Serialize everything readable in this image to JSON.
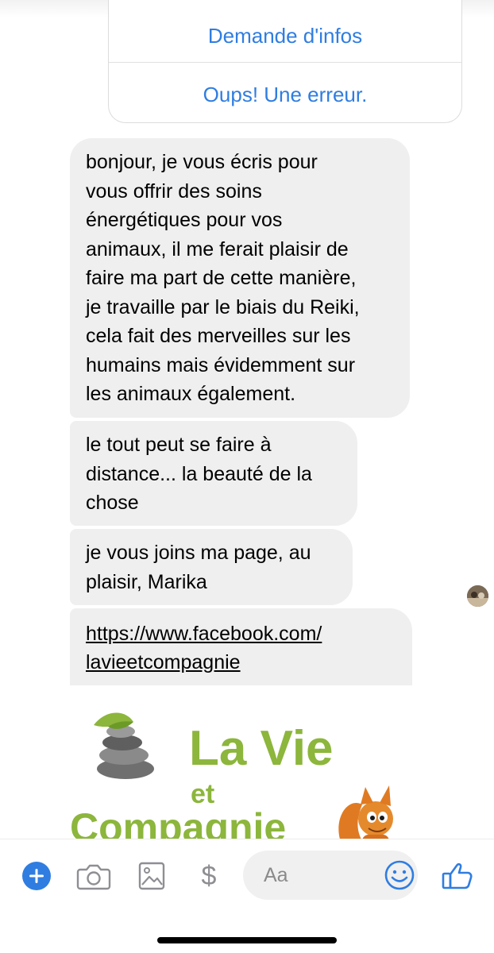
{
  "quick_replies": [
    "Demande d'infos",
    "Oups! Une erreur."
  ],
  "messages": {
    "first": [
      "bonjour, je vous écris pour",
      "vous offrir des soins",
      "énergétiques pour vos",
      "animaux, il me ferait plaisir de",
      "faire ma part de cette manière,",
      "je travaille par le biais du Reiki,",
      "cela fait des merveilles sur les",
      "humains mais évidemment sur",
      "les animaux également."
    ],
    "second": [
      "le tout peut se faire à",
      "distance... la beauté de la",
      "chose"
    ],
    "third": [
      "je vous joins ma page, au",
      "plaisir, Marika"
    ],
    "link": [
      "https://www.facebook.com/",
      "lavieetcompagnie"
    ]
  },
  "link_preview": {
    "logo_text_1": "La Vie",
    "logo_text_2": "et",
    "logo_text_3": "Compagnie",
    "brand_green": "#8cb63c"
  },
  "composer": {
    "placeholder": "Aa",
    "icons": [
      "plus-icon",
      "camera-icon",
      "image-icon",
      "dollar-icon",
      "emoji-icon",
      "thumbs-up-icon"
    ],
    "accent": "#2f7de1"
  }
}
